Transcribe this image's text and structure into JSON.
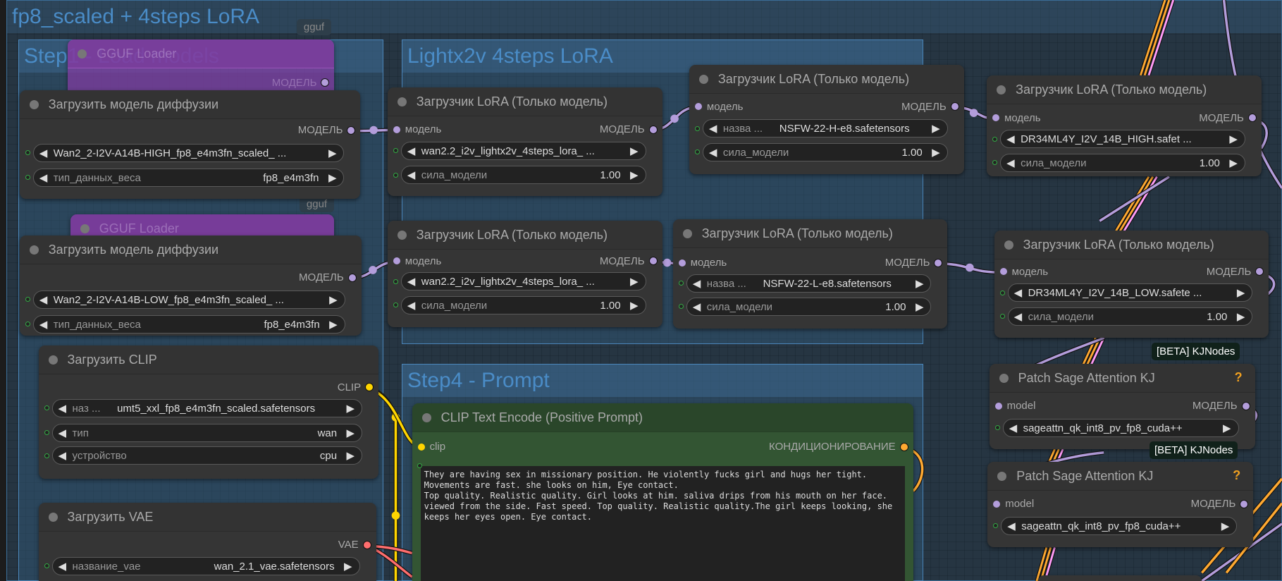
{
  "groups": {
    "outer": {
      "title": "fp8_scaled +  4steps LoRA"
    },
    "step1": {
      "title": "Step1 - Load models"
    },
    "lightx2v": {
      "title": "Lightx2v 4steps LoRA"
    },
    "step4": {
      "title": "Step4 -  Prompt"
    }
  },
  "badges": {
    "gguf_1": "gguf",
    "gguf_2": "gguf",
    "kj_1": "[BETA] KJNodes",
    "kj_2": "[BETA] KJNodes"
  },
  "colors": {
    "model": "#b39ddb",
    "clip": "#ffd500",
    "vae": "#ff6e6e",
    "conditioning": "#ffa931",
    "latent": "#ff9cf9"
  },
  "nodes": [
    {
      "id": "gguf1",
      "title": "GGUF Loader",
      "style": "purple",
      "inputs": [],
      "outputs": [
        {
          "label": "МОДЕЛЬ",
          "type": "model"
        }
      ],
      "widgets": []
    },
    {
      "id": "unet_high",
      "title": "Загрузить модель диффузии",
      "inputs": [],
      "outputs": [
        {
          "label": "МОДЕЛЬ",
          "type": "model"
        }
      ],
      "widgets": [
        {
          "label": "",
          "value": "Wan2_2-I2V-A14B-HIGH_fp8_e4m3fn_scaled_ ..."
        },
        {
          "label": "тип_данных_веса",
          "value": "fp8_e4m3fn"
        }
      ]
    },
    {
      "id": "gguf2",
      "title": "GGUF Loader",
      "style": "purple",
      "inputs": [],
      "outputs": [],
      "widgets": []
    },
    {
      "id": "unet_low",
      "title": "Загрузить модель диффузии",
      "inputs": [],
      "outputs": [
        {
          "label": "МОДЕЛЬ",
          "type": "model"
        }
      ],
      "widgets": [
        {
          "label": "",
          "value": "Wan2_2-I2V-A14B-LOW_fp8_e4m3fn_scaled_ ..."
        },
        {
          "label": "тип_данных_веса",
          "value": "fp8_e4m3fn"
        }
      ]
    },
    {
      "id": "clip",
      "title": "Загрузить CLIP",
      "inputs": [],
      "outputs": [
        {
          "label": "CLIP",
          "type": "clip"
        }
      ],
      "widgets": [
        {
          "label": "наз ...",
          "value": "umt5_xxl_fp8_e4m3fn_scaled.safetensors"
        },
        {
          "label": "тип",
          "value": "wan"
        },
        {
          "label": "устройство",
          "value": "cpu"
        }
      ]
    },
    {
      "id": "vae",
      "title": "Загрузить VAE",
      "inputs": [],
      "outputs": [
        {
          "label": "VAE",
          "type": "vae"
        }
      ],
      "widgets": [
        {
          "label": "название_vae",
          "value": "wan_2.1_vae.safetensors"
        }
      ]
    },
    {
      "id": "lora_lx_high",
      "title": "Загрузчик LoRA (Только модель)",
      "inputs": [
        {
          "label": "модель",
          "type": "model"
        }
      ],
      "outputs": [
        {
          "label": "МОДЕЛЬ",
          "type": "model"
        }
      ],
      "widgets": [
        {
          "label": "",
          "value": "wan2.2_i2v_lightx2v_4steps_lora_ ..."
        },
        {
          "label": "сила_модели",
          "value": "1.00"
        }
      ]
    },
    {
      "id": "lora_nsfw_high",
      "title": "Загрузчик LoRA (Только модель)",
      "inputs": [
        {
          "label": "модель",
          "type": "model"
        }
      ],
      "outputs": [
        {
          "label": "МОДЕЛЬ",
          "type": "model"
        }
      ],
      "widgets": [
        {
          "label": "назва ...",
          "value": "NSFW-22-H-e8.safetensors"
        },
        {
          "label": "сила_модели",
          "value": "1.00"
        }
      ]
    },
    {
      "id": "lora_dr_high",
      "title": "Загрузчик LoRA (Только модель)",
      "inputs": [
        {
          "label": "модель",
          "type": "model"
        }
      ],
      "outputs": [
        {
          "label": "МОДЕЛЬ",
          "type": "model"
        }
      ],
      "widgets": [
        {
          "label": "",
          "value": "DR34ML4Y_I2V_14B_HIGH.safet  ..."
        },
        {
          "label": "сила_модели",
          "value": "1.00"
        }
      ]
    },
    {
      "id": "lora_lx_low",
      "title": "Загрузчик LoRA (Только модель)",
      "inputs": [
        {
          "label": "модель",
          "type": "model"
        }
      ],
      "outputs": [
        {
          "label": "МОДЕЛЬ",
          "type": "model"
        }
      ],
      "widgets": [
        {
          "label": "",
          "value": "wan2.2_i2v_lightx2v_4steps_lora_ ..."
        },
        {
          "label": "сила_модели",
          "value": "1.00"
        }
      ]
    },
    {
      "id": "lora_nsfw_low",
      "title": "Загрузчик LoRA (Только модель)",
      "inputs": [
        {
          "label": "модель",
          "type": "model"
        }
      ],
      "outputs": [
        {
          "label": "МОДЕЛЬ",
          "type": "model"
        }
      ],
      "widgets": [
        {
          "label": "назва ...",
          "value": "NSFW-22-L-e8.safetensors"
        },
        {
          "label": "сила_модели",
          "value": "1.00"
        }
      ]
    },
    {
      "id": "lora_dr_low",
      "title": "Загрузчик LoRA (Только модель)",
      "inputs": [
        {
          "label": "модель",
          "type": "model"
        }
      ],
      "outputs": [
        {
          "label": "МОДЕЛЬ",
          "type": "model"
        }
      ],
      "widgets": [
        {
          "label": "",
          "value": "DR34ML4Y_I2V_14B_LOW.safete ..."
        },
        {
          "label": "сила_модели",
          "value": "1.00"
        }
      ]
    },
    {
      "id": "sage1",
      "title": "Patch Sage Attention KJ",
      "help": "?",
      "inputs": [
        {
          "label": "model",
          "type": "model"
        }
      ],
      "outputs": [
        {
          "label": "МОДЕЛЬ",
          "type": "model"
        }
      ],
      "widgets": [
        {
          "label": "",
          "value": "sageattn_qk_int8_pv_fp8_cuda++"
        }
      ]
    },
    {
      "id": "sage2",
      "title": "Patch Sage Attention KJ",
      "help": "?",
      "inputs": [
        {
          "label": "model",
          "type": "model"
        }
      ],
      "outputs": [
        {
          "label": "МОДЕЛЬ",
          "type": "model"
        }
      ],
      "widgets": [
        {
          "label": "",
          "value": "sageattn_qk_int8_pv_fp8_cuda++"
        }
      ]
    },
    {
      "id": "clip_text",
      "title": "CLIP Text Encode (Positive Prompt)",
      "style": "green",
      "inputs": [
        {
          "label": "clip",
          "type": "clip"
        }
      ],
      "outputs": [
        {
          "label": "КОНДИЦИОНИРОВАНИЕ",
          "type": "conditioning"
        }
      ],
      "widgets": [],
      "text": "They are having sex in missionary position. He violently fucks girl and hugs her tight. Movements are fast. she looks on him, Eye contact.\nTop quality. Realistic quality. Girl looks at him. saliva drips from his mouth on her face. viewed from the side. Fast speed. Top quality. Realistic quality.The girl keeps looking, she keeps her eyes open. Eye contact."
    }
  ]
}
